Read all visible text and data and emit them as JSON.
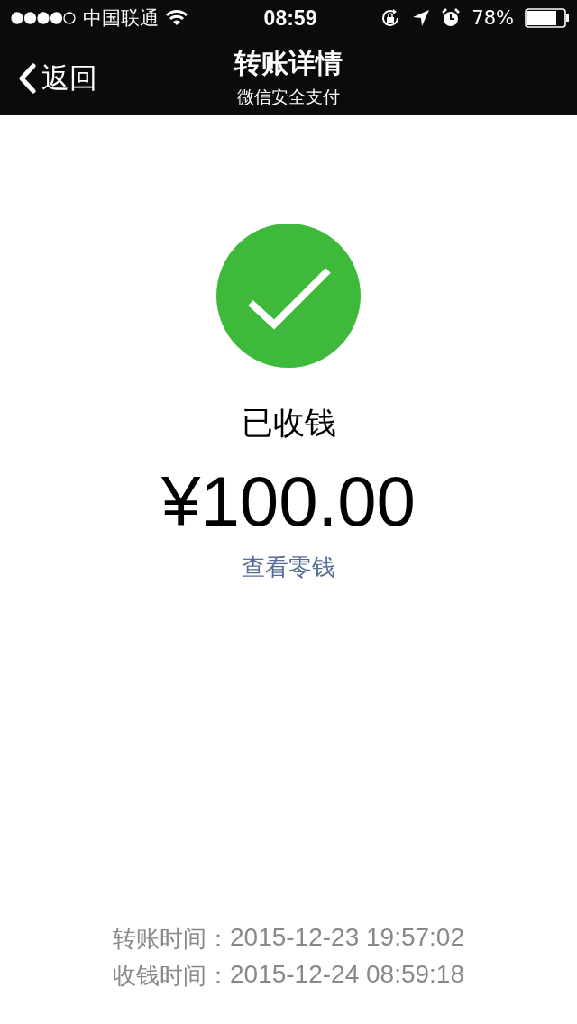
{
  "status_bar": {
    "carrier": "中国联通",
    "time": "08:59",
    "battery_text": "78%"
  },
  "nav_bar": {
    "back": "返回",
    "title": "转账详情",
    "subtitle": "微信安全支付"
  },
  "result": {
    "status": "已收钱",
    "amount": "¥100.00",
    "link": "查看零钱"
  },
  "times": [
    {
      "label": "转账时间：",
      "value": "2015-12-23 19:57:02"
    },
    {
      "label": "收钱时间：",
      "value": "2015-12-24 08:59:18"
    }
  ]
}
